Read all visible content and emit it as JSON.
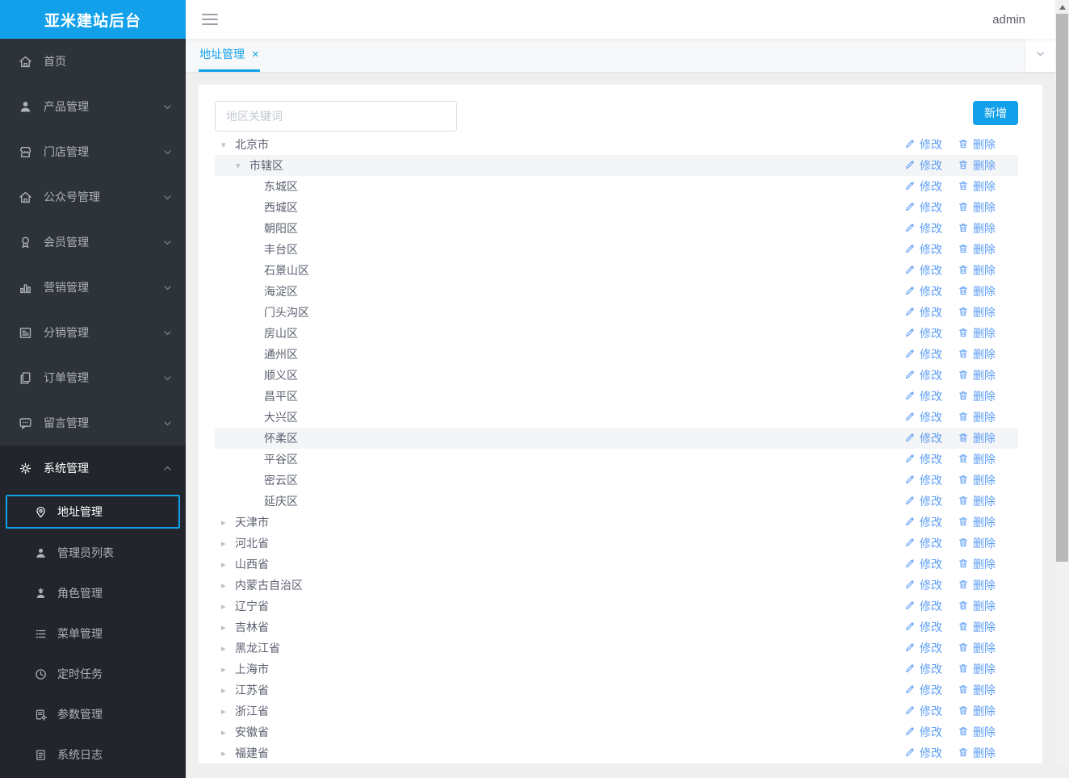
{
  "app": {
    "logo_text": "亚米建站后台",
    "username": "admin"
  },
  "colors": {
    "brand_blue": "#11a0e9",
    "link_blue": "#5c9df5",
    "sidebar_bg": "#2e333a",
    "sidebar_expanded_bg": "#22262c",
    "highlight_row": "#f4f5f7"
  },
  "sidebar": {
    "items": [
      {
        "key": "home",
        "label": "首页",
        "icon": "home-icon",
        "has_children": false,
        "expanded": false
      },
      {
        "key": "products",
        "label": "产品管理",
        "icon": "user-icon",
        "has_children": true,
        "expanded": false
      },
      {
        "key": "stores",
        "label": "门店管理",
        "icon": "shop-icon",
        "has_children": true,
        "expanded": false
      },
      {
        "key": "official-accounts",
        "label": "公众号管理",
        "icon": "official-account-icon",
        "has_children": true,
        "expanded": false
      },
      {
        "key": "members",
        "label": "会员管理",
        "icon": "member-badge-icon",
        "has_children": true,
        "expanded": false
      },
      {
        "key": "marketing",
        "label": "营销管理",
        "icon": "bar-chart-icon",
        "has_children": true,
        "expanded": false
      },
      {
        "key": "distribution",
        "label": "分销管理",
        "icon": "layout-icon",
        "has_children": true,
        "expanded": false
      },
      {
        "key": "orders",
        "label": "订单管理",
        "icon": "order-doc-icon",
        "has_children": true,
        "expanded": false
      },
      {
        "key": "messages",
        "label": "留言管理",
        "icon": "message-icon",
        "has_children": true,
        "expanded": false
      },
      {
        "key": "system",
        "label": "系统管理",
        "icon": "gear-icon",
        "has_children": true,
        "expanded": true
      }
    ],
    "submenu": [
      {
        "key": "addresses",
        "label": "地址管理",
        "icon": "location-pin-icon",
        "active": true
      },
      {
        "key": "admin-list",
        "label": "管理员列表",
        "icon": "admin-user-icon",
        "active": false
      },
      {
        "key": "roles",
        "label": "角色管理",
        "icon": "role-user-icon",
        "active": false
      },
      {
        "key": "menus",
        "label": "菜单管理",
        "icon": "menu-list-icon",
        "active": false
      },
      {
        "key": "cron",
        "label": "定时任务",
        "icon": "clock-icon",
        "active": false
      },
      {
        "key": "params",
        "label": "参数管理",
        "icon": "doc-gear-icon",
        "active": false
      },
      {
        "key": "logs",
        "label": "系统日志",
        "icon": "doc-icon",
        "active": false
      }
    ]
  },
  "tabs": {
    "active_label": "地址管理",
    "close_label": "×"
  },
  "toolbar": {
    "search_placeholder": "地区关键词",
    "search_value": "",
    "add_button": "新增"
  },
  "actions": {
    "edit": "修改",
    "delete": "删除"
  },
  "tree": {
    "rows": [
      {
        "label": "北京市",
        "level": 0,
        "state": "expanded",
        "highlighted": false
      },
      {
        "label": "市辖区",
        "level": 1,
        "state": "expanded",
        "highlighted": true
      },
      {
        "label": "东城区",
        "level": 2,
        "state": "leaf",
        "highlighted": false
      },
      {
        "label": "西城区",
        "level": 2,
        "state": "leaf",
        "highlighted": false
      },
      {
        "label": "朝阳区",
        "level": 2,
        "state": "leaf",
        "highlighted": false
      },
      {
        "label": "丰台区",
        "level": 2,
        "state": "leaf",
        "highlighted": false
      },
      {
        "label": "石景山区",
        "level": 2,
        "state": "leaf",
        "highlighted": false
      },
      {
        "label": "海淀区",
        "level": 2,
        "state": "leaf",
        "highlighted": false
      },
      {
        "label": "门头沟区",
        "level": 2,
        "state": "leaf",
        "highlighted": false
      },
      {
        "label": "房山区",
        "level": 2,
        "state": "leaf",
        "highlighted": false
      },
      {
        "label": "通州区",
        "level": 2,
        "state": "leaf",
        "highlighted": false
      },
      {
        "label": "顺义区",
        "level": 2,
        "state": "leaf",
        "highlighted": false
      },
      {
        "label": "昌平区",
        "level": 2,
        "state": "leaf",
        "highlighted": false
      },
      {
        "label": "大兴区",
        "level": 2,
        "state": "leaf",
        "highlighted": false
      },
      {
        "label": "怀柔区",
        "level": 2,
        "state": "leaf",
        "highlighted": true
      },
      {
        "label": "平谷区",
        "level": 2,
        "state": "leaf",
        "highlighted": false
      },
      {
        "label": "密云区",
        "level": 2,
        "state": "leaf",
        "highlighted": false
      },
      {
        "label": "延庆区",
        "level": 2,
        "state": "leaf",
        "highlighted": false
      },
      {
        "label": "天津市",
        "level": 0,
        "state": "collapsed",
        "highlighted": false
      },
      {
        "label": "河北省",
        "level": 0,
        "state": "collapsed",
        "highlighted": false
      },
      {
        "label": "山西省",
        "level": 0,
        "state": "collapsed",
        "highlighted": false
      },
      {
        "label": "内蒙古自治区",
        "level": 0,
        "state": "collapsed",
        "highlighted": false
      },
      {
        "label": "辽宁省",
        "level": 0,
        "state": "collapsed",
        "highlighted": false
      },
      {
        "label": "吉林省",
        "level": 0,
        "state": "collapsed",
        "highlighted": false
      },
      {
        "label": "黑龙江省",
        "level": 0,
        "state": "collapsed",
        "highlighted": false
      },
      {
        "label": "上海市",
        "level": 0,
        "state": "collapsed",
        "highlighted": false
      },
      {
        "label": "江苏省",
        "level": 0,
        "state": "collapsed",
        "highlighted": false
      },
      {
        "label": "浙江省",
        "level": 0,
        "state": "collapsed",
        "highlighted": false
      },
      {
        "label": "安徽省",
        "level": 0,
        "state": "collapsed",
        "highlighted": false
      },
      {
        "label": "福建省",
        "level": 0,
        "state": "collapsed",
        "highlighted": false
      }
    ]
  }
}
